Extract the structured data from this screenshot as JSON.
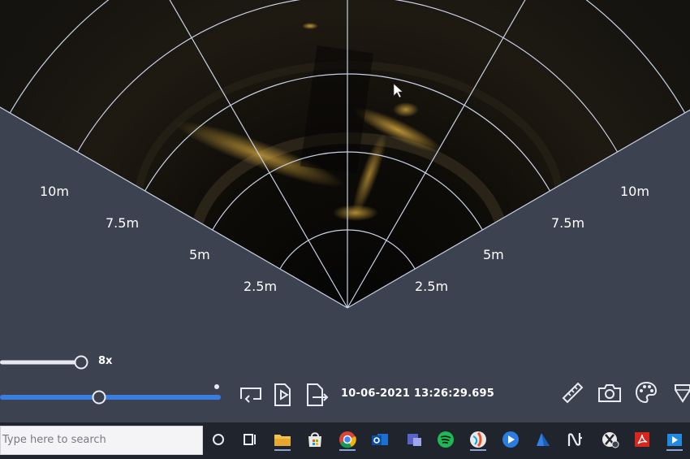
{
  "sonar": {
    "range_labels_left": [
      "10m",
      "7.5m",
      "5m",
      "2.5m"
    ],
    "range_labels_right": [
      "10m",
      "7.5m",
      "5m",
      "2.5m"
    ],
    "colors": {
      "grid": "#c8d2e6",
      "outside": "#3c4250"
    }
  },
  "controls": {
    "zoom_label": "8x",
    "zoom_level_percent": 100,
    "playback_position_percent": 45,
    "timestamp": "10-06-2021 13:26:29.695",
    "accent_color": "#3a7de0"
  },
  "control_icons": [
    "loop-icon",
    "play-file-icon",
    "export-file-icon",
    "ruler-icon",
    "camera-icon",
    "palette-icon",
    "diamond-icon"
  ],
  "taskbar": {
    "search_placeholder": "Type here to search",
    "apps": [
      "search-circle-icon",
      "task-view-icon",
      "file-explorer-icon",
      "store-icon",
      "chrome-icon",
      "outlook-icon",
      "teams-icon",
      "spotify-icon",
      "photos-icon",
      "media-player-icon",
      "maps-icon",
      "notion-icon",
      "xbox-icon",
      "acrobat-icon",
      "movies-icon"
    ]
  }
}
